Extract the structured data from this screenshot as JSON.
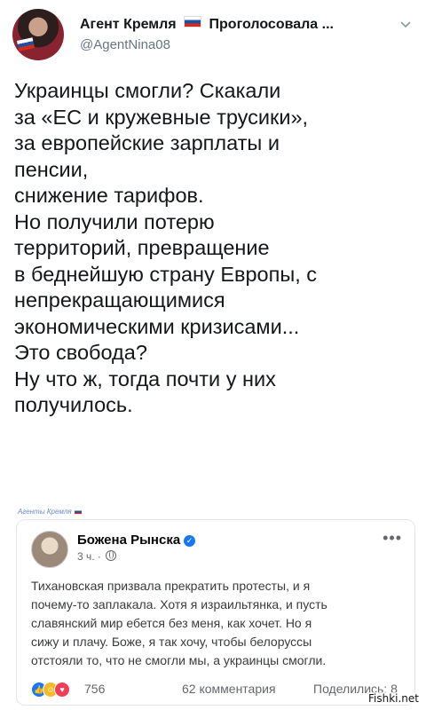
{
  "tweet": {
    "display_name": "Агент Кремля",
    "display_name_suffix": "Проголосовала ...",
    "handle": "@AgentNina08",
    "text": "Украинцы смогли? Скакали\nза «ЕС и кружевные трусики»,\nза европейские зарплаты и\nпенсии,\nснижение тарифов.\nНо получили потерю\nтерриторий, превращение\nв беднейшую страну Европы, с\nнепрекращающимися\nэкономическими кризисами...\nЭто свобода?\nНу что ж, тогда почти у них\nполучилось.",
    "icons": {
      "flag": "russia-flag-icon",
      "menu": "chevron-down-icon"
    }
  },
  "watermark_top": "Агенты Кремля",
  "fb_post": {
    "author": "Божена Рынска",
    "time": "3 ч. ·",
    "text": "Тихановская призвала прекратить протесты, и я\nпочему-то заплакала. Хотя я израильтянка, и пусть\nславянский мир ебется без меня, как хочет. Но я\nсижу и плачу. Боже, я так хочу, чтобы белоруссы\nотстояли то, что не смогли мы, а украинцы смогли.",
    "reactions_count": "756",
    "comments": "62 комментария",
    "shares": "Поделились: 8",
    "icons": {
      "verified": "verified-badge-icon",
      "privacy": "globe-icon",
      "more": "more-options-icon"
    }
  },
  "site_watermark": "Fishki.net",
  "colors": {
    "fb_blue": "#1877f2",
    "twitter_gray": "#657786"
  }
}
